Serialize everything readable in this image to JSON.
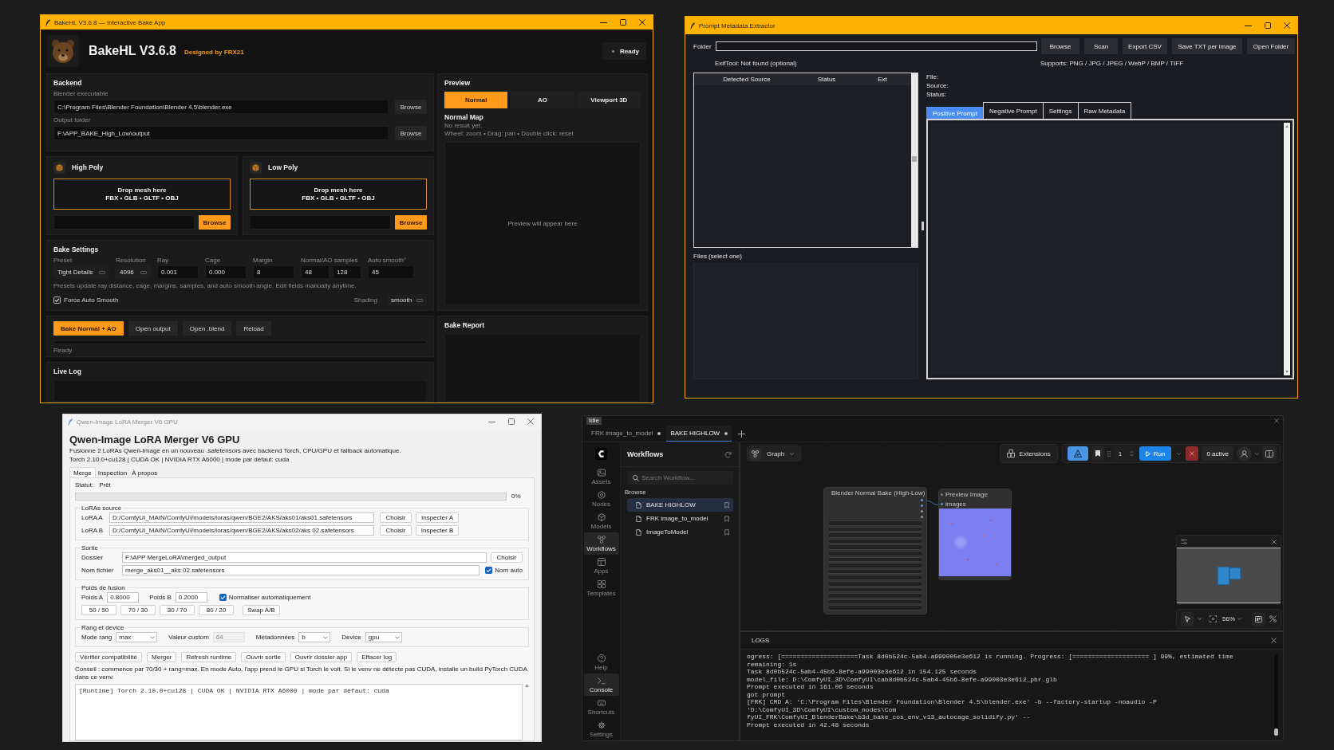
{
  "bake_app": {
    "title": "BakeHL V3.6.8 — Interactive Bake App",
    "header": {
      "app_name": "BakeHL V3.6.8",
      "credit": "Designed by FRX21",
      "status": "Ready"
    },
    "backend": {
      "title": "Backend",
      "fields": [
        {
          "label": "Blender executable",
          "value": "C:\\Program Files\\Blender Foundation\\Blender 4.5\\blender.exe",
          "button": "Browse"
        },
        {
          "label": "Output folder",
          "value": "F:\\APP_BAKE_High_Low\\output",
          "button": "Browse"
        }
      ]
    },
    "mesh_panels": [
      {
        "title": "High Poly",
        "drop_text": "Drop mesh here",
        "formats": "FBX • GLB • GLTF • OBJ",
        "button": "Browse"
      },
      {
        "title": "Low Poly",
        "drop_text": "Drop mesh here",
        "formats": "FBX • GLB • GLTF • OBJ",
        "button": "Browse"
      }
    ],
    "bake_settings": {
      "title": "Bake Settings",
      "fields": [
        {
          "label": "Preset",
          "kind": "select",
          "values": [
            "Tight Details"
          ]
        },
        {
          "label": "Resolution",
          "kind": "select",
          "values": [
            "4096"
          ]
        },
        {
          "label": "Ray",
          "kind": "input",
          "values": [
            "0.001"
          ]
        },
        {
          "label": "Cage",
          "kind": "input",
          "values": [
            "0.000"
          ]
        },
        {
          "label": "Margin",
          "kind": "input",
          "values": [
            "8"
          ]
        },
        {
          "label": "Normal/AO samples",
          "kind": "input",
          "values": [
            "48",
            "128"
          ]
        },
        {
          "label": "Auto smooth°",
          "kind": "input",
          "values": [
            "45"
          ]
        }
      ],
      "hint": "Presets update ray distance, cage, margins, samples, and auto smooth angle. Edit fields manually anytime.",
      "force_auto_smooth": {
        "label": "Force Auto Smooth",
        "checked": true
      },
      "shading": {
        "label": "Shading",
        "value": "smooth"
      }
    },
    "actions": {
      "buttons": [
        {
          "label": "Bake Normal + AO",
          "primary": true
        },
        {
          "label": "Open output",
          "primary": false
        },
        {
          "label": "Open .blend",
          "primary": false
        },
        {
          "label": "Reload",
          "primary": false
        }
      ],
      "progress": {
        "level": 0
      },
      "status": "Ready"
    },
    "live_log": {
      "title": "Live Log"
    },
    "preview": {
      "title": "Preview",
      "tabs": [
        {
          "label": "Normal",
          "selected": true
        },
        {
          "label": "AO",
          "selected": false
        },
        {
          "label": "Viewport 3D",
          "selected": false
        }
      ],
      "map_title": "Normal Map",
      "result": "No result yet.",
      "hint": "Wheel: zoom • Drag: pan • Double click: reset",
      "placeholder": "Preview will appear here"
    },
    "bake_report": {
      "title": "Bake Report"
    }
  },
  "metadata_extractor": {
    "title": "Prompt Metadata Extractor",
    "folder": {
      "label": "Folder"
    },
    "buttons": [
      "Browse",
      "Scan",
      "Export CSV",
      "Save TXT per image",
      "Open Folder"
    ],
    "exiftool": "ExifTool: Not found (optional)",
    "supports": "Supports: PNG / JPG / JPEG / WebP / BMP / TIFF",
    "table": {
      "columns": [
        "Detected Source",
        "Status",
        "Ext"
      ]
    },
    "files_label": "Files (select one)",
    "info": [
      "File:",
      "Source:",
      "Status:"
    ],
    "tabs": [
      {
        "label": "Positive Prompt",
        "selected": true
      },
      {
        "label": "Negative Prompt",
        "selected": false
      },
      {
        "label": "Settings",
        "selected": false
      },
      {
        "label": "Raw Metadata",
        "selected": false
      }
    ]
  },
  "lora_merger": {
    "title": "Qwen-Image LoRA Merger V6 GPU",
    "heading": "Qwen-Image LoRA Merger V6 GPU",
    "description": "Fusionne 2 LoRAs Qwen-Image en un nouveau .safetensors avec backend Torch, CPU/GPU et fallback automatique.",
    "runtime": "Torch 2.10.0+cu128 | CUDA OK | NVIDIA RTX A6000 | mode par défaut: cuda",
    "tabs": [
      {
        "label": "Merge",
        "selected": true
      },
      {
        "label": "Inspection",
        "selected": false
      },
      {
        "label": "À propos",
        "selected": false
      }
    ],
    "status": {
      "label": "Statut:",
      "value": "Prêt",
      "progress": {
        "level": 0
      },
      "percent": "0%"
    },
    "sources": {
      "title": "LoRAs source",
      "rows": [
        {
          "label": "LoRA A",
          "value": "D:/ComfyUI_MAIN/ComfyUI/models/loras/qwen/BGE2/AKS/aks01/aks01.safetensors",
          "buttons": [
            "Choisir",
            "Inspecter A"
          ]
        },
        {
          "label": "LoRA B",
          "value": "D:/ComfyUI_MAIN/ComfyUI/models/loras/qwen/BGE2/AKS/aks02/aks 02.safetensors",
          "buttons": [
            "Choisir",
            "Inspecter B"
          ]
        }
      ]
    },
    "output": {
      "title": "Sortie",
      "folder": {
        "label": "Dossier",
        "value": "F:\\APP MergeLoRA\\merged_output",
        "button": "Choisir"
      },
      "filename": {
        "label": "Nom fichier",
        "value": "merge_aks01__aks 02.safetensors",
        "auto": {
          "label": "Nom auto",
          "checked": true
        }
      }
    },
    "weights": {
      "title": "Poids de fusion",
      "fields": [
        {
          "label": "Poids A",
          "value": "0.8000"
        },
        {
          "label": "Poids B",
          "value": "0.2000"
        }
      ],
      "normalize": {
        "label": "Normaliser automatiquement",
        "checked": true
      },
      "presets": [
        "50 / 50",
        "70 / 30",
        "30 / 70",
        "80 / 20",
        "Swap A/B"
      ]
    },
    "rank": {
      "title": "Rang et device",
      "fields": [
        {
          "label": "Mode rang",
          "kind": "select",
          "value": "max",
          "disabled": false
        },
        {
          "label": "Valeur custom",
          "kind": "input",
          "value": "64",
          "disabled": true
        },
        {
          "label": "Métadonnées",
          "kind": "select",
          "value": "b",
          "disabled": false
        },
        {
          "label": "Device",
          "kind": "select",
          "value": "gpu",
          "disabled": false
        }
      ]
    },
    "actions": [
      "Vérifier compatibilité",
      "Merger",
      "Refresh runtime",
      "Ouvrir sortie",
      "Ouvrir dossier app",
      "Effacer log"
    ],
    "tip": "Conseil : commence par 70/30 + rang=max. En mode Auto, l'app prend le GPU si Torch le voit. Si le venv ne détecte pas CUDA, installe un build PyTorch CUDA dans ce venv.",
    "log": "[Runtime] Torch 2.10.0+cu128 | CUDA OK | NVIDIA RTX A6000 | mode par défaut: cuda"
  },
  "comfyui": {
    "status": "Idle",
    "tabs": [
      {
        "label": "FRK image_to_model",
        "selected": false,
        "unsaved": true
      },
      {
        "label": "BAKE HIGHLOW",
        "selected": true,
        "unsaved": true
      }
    ],
    "rail": {
      "top": [
        {
          "kind": "assets",
          "label": "Assets",
          "selected": false
        },
        {
          "kind": "nodes",
          "label": "Nodes",
          "selected": false
        },
        {
          "kind": "models",
          "label": "Models",
          "selected": false
        },
        {
          "kind": "workflows",
          "label": "Workflows",
          "selected": true
        },
        {
          "kind": "apps",
          "label": "Apps",
          "selected": false
        },
        {
          "kind": "templates",
          "label": "Templates",
          "selected": false
        }
      ],
      "bottom": [
        {
          "kind": "help",
          "label": "Help",
          "selected": false
        },
        {
          "kind": "console",
          "label": "Console",
          "selected": true
        },
        {
          "kind": "shortcuts",
          "label": "Shortcuts",
          "selected": false
        },
        {
          "kind": "settings",
          "label": "Settings",
          "selected": false
        }
      ]
    },
    "workflows": {
      "title": "Workflows",
      "search": {
        "placeholder": "Search Workflow..."
      },
      "section": "Browse",
      "items": [
        {
          "label": "BAKE HIGHLOW",
          "selected": true
        },
        {
          "label": "FRK image_to_model",
          "selected": false
        },
        {
          "label": "ImageToModel",
          "selected": false
        }
      ]
    },
    "toolbar": {
      "view": "Graph",
      "extensions": "Extensions",
      "batch_count": "1",
      "run": "Run",
      "active": "0 active"
    },
    "nodes": [
      {
        "kind": "bake",
        "title": "Blender Normal Bake (High-Low)"
      },
      {
        "kind": "preview",
        "title": "Preview Image",
        "input": "images"
      }
    ],
    "minimap": {
      "zoom": "56%"
    },
    "logs": {
      "title": "LOGS",
      "lines": [
        "ogress: [====================Task 8d0b524c-5ab4-a999005e3e612 is running. Progress: [==================== ] 99%, estimated time remaining: 1s",
        "Task 8d0b524c-5ab4-45b6-8efe-a99003e3e612 in 154.125 seconds",
        "model_file: D:\\ComfyUI_3D\\ComfyUI\\cab8d0b524c-5ab4-45b6-8efe-a99003e3e612_pbr.glb",
        "Prompt executed in 161.06 seconds",
        "got prompt",
        "[FRK] CMD A: 'C:\\Program Files\\Blender Foundation\\Blender 4.5\\blender.exe' -b --factory-startup -noaudio -P 'D:\\ComfyUI_3D\\ComfyUI\\custom_nodes\\Com",
        "fyUI_FRK\\ComfyUI_BlenderBake\\b3d_bake_cos_env_v13_autocage_solidify.py' --",
        "Prompt executed in 42.48 seconds"
      ]
    }
  }
}
